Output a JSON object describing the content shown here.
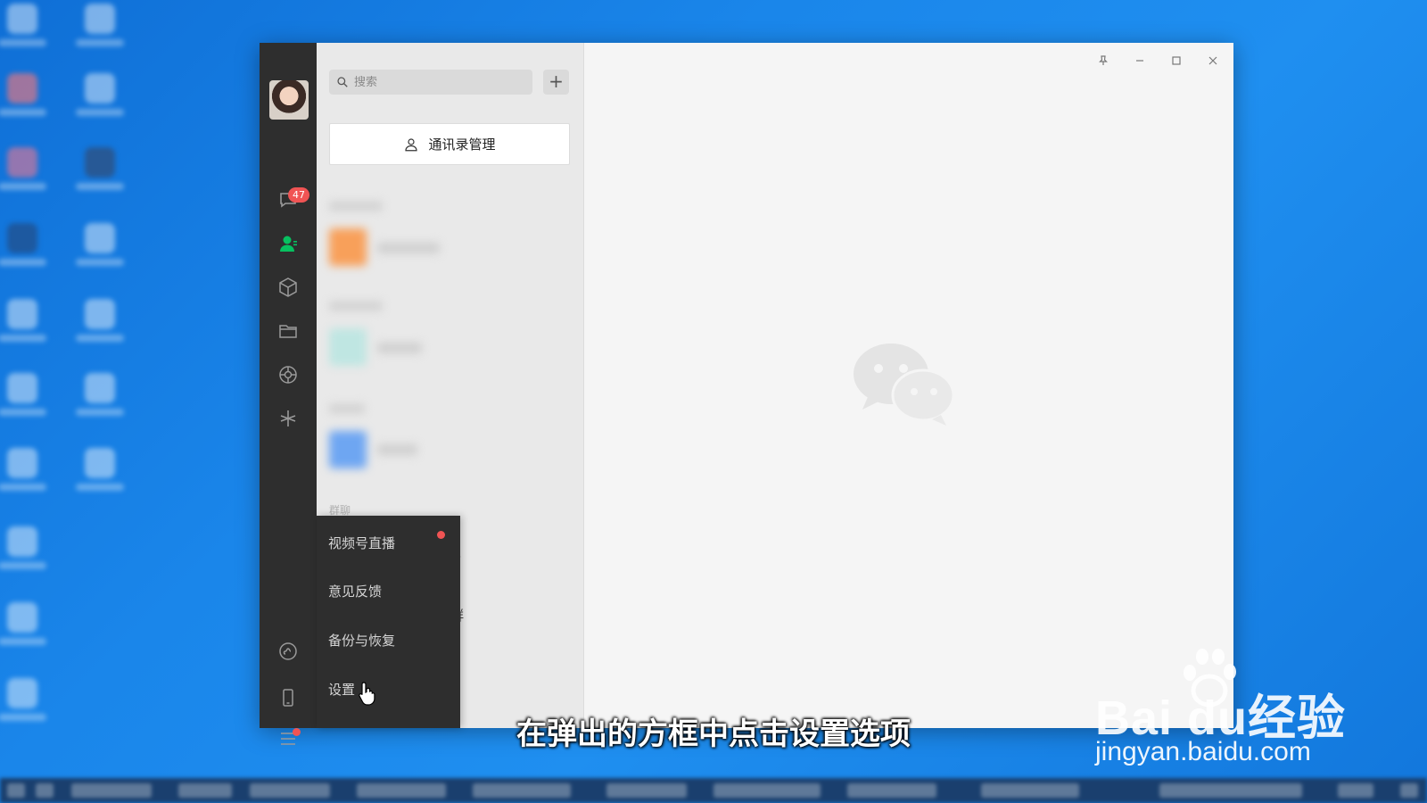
{
  "window": {
    "sidebar": {
      "unread_badge": "47"
    },
    "list": {
      "search_placeholder": "搜索",
      "add_symbol": "+",
      "contacts_management": "通讯录管理",
      "group_section_label": "群聊",
      "partial_text_1": "乐",
      "partial_text_2": "群"
    },
    "menu": {
      "items": [
        "视频号直播",
        "意见反馈",
        "备份与恢复",
        "设置"
      ]
    }
  },
  "subtitle": "在弹出的方框中点击设置选项",
  "watermark": {
    "brand": "Bai  du经验",
    "url": "jingyan.baidu.com"
  },
  "colors": {
    "rail": "#2e2e2e",
    "accent_green": "#07c160",
    "badge_red": "#f05454",
    "desktop_blue": "#1a86ea"
  }
}
